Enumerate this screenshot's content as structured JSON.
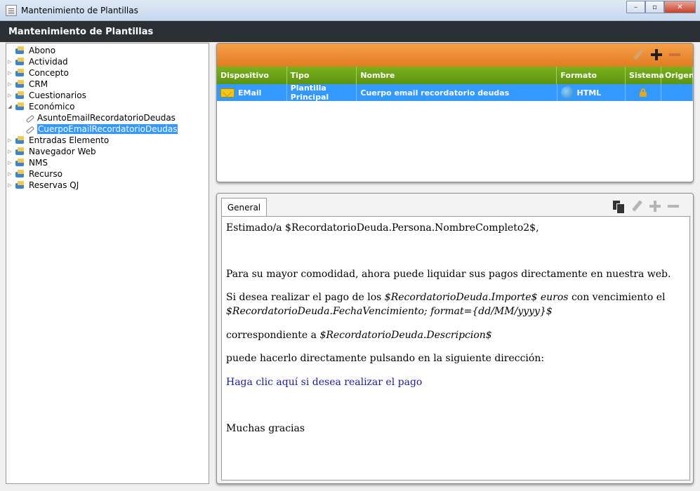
{
  "window": {
    "title": "Mantenimiento de Plantillas",
    "minimize": "–",
    "maximize": "▫",
    "close": "✕"
  },
  "header": {
    "title": "Mantenimiento de Plantillas"
  },
  "tree": {
    "items": [
      {
        "label": "Abono",
        "expander": ""
      },
      {
        "label": "Actividad",
        "expander": "▷"
      },
      {
        "label": "Concepto",
        "expander": "▷"
      },
      {
        "label": "CRM",
        "expander": "▷"
      },
      {
        "label": "Cuestionarios",
        "expander": "▷"
      },
      {
        "label": "Económico",
        "expander": "◢"
      },
      {
        "label": "AsuntoEmailRecordatorioDeudas",
        "child": true
      },
      {
        "label": "CuerpoEmailRecordatorioDeudas",
        "child": true,
        "selected": true
      },
      {
        "label": "Entradas Elemento",
        "expander": "▷"
      },
      {
        "label": "Navegador Web",
        "expander": "▷"
      },
      {
        "label": "NMS",
        "expander": "▷"
      },
      {
        "label": "Recurso",
        "expander": "▷"
      },
      {
        "label": "Reservas QJ",
        "expander": "▷"
      }
    ]
  },
  "grid": {
    "columns": [
      "Dispositivo",
      "Tipo",
      "Nombre",
      "Formato",
      "Sistema",
      "Origen"
    ],
    "rows": [
      {
        "dispositivo": "EMail",
        "tipo": "Plantilla Principal",
        "nombre": "Cuerpo email recordatorio deudas",
        "formato": "HTML",
        "sistema_icon": "lock-icon",
        "origen": ""
      }
    ]
  },
  "editor": {
    "tab": "General",
    "greeting": "Estimado/a $RecordatorioDeuda.Persona.NombreCompleto2$,",
    "line1": "Para su mayor comodidad, ahora puede liquidar sus pagos directamente en nuestra web.",
    "line2_prefix": "Si desea realizar el pago de los ",
    "line2_var": "$RecordatorioDeuda.Importe$ euros",
    "line2_suffix": " con vencimiento el",
    "line2b_var": "$RecordatorioDeuda.FechaVencimiento; format={dd/MM/yyyy}$",
    "line3_prefix": "correspondiente a ",
    "line3_var": "$RecordatorioDeuda.Descripcion$",
    "line4": "puede hacerlo directamente pulsando en la siguiente dirección:",
    "link": "Haga clic aquí si desea realizar el pago",
    "closing": "Muchas gracias"
  },
  "colors": {
    "header_bg": "#2b3035",
    "toolbar_orange": "#e27c22",
    "grid_header_green": "#5c9412",
    "selection_blue": "#3399ff",
    "link_blue": "#1a1aa6"
  },
  "icons": [
    "app-icon",
    "folder-icon",
    "link-icon",
    "pencil-icon",
    "plus-icon",
    "minus-icon",
    "envelope-icon",
    "html-icon",
    "lock-icon",
    "copy-icon"
  ]
}
